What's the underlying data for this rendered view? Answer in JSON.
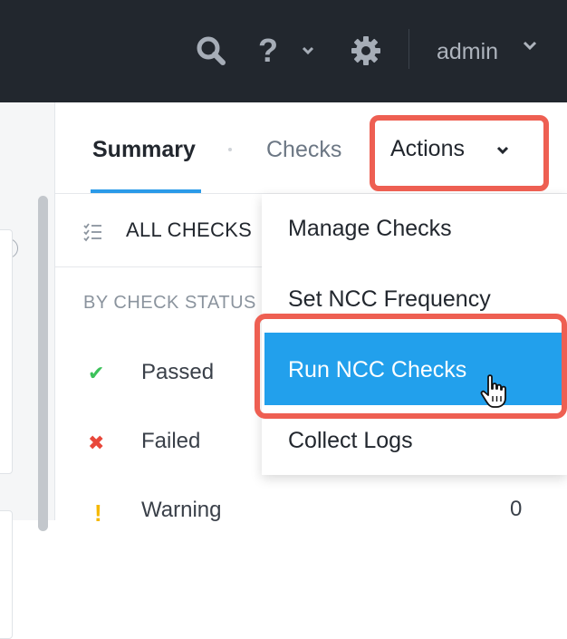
{
  "topbar": {
    "icons": [
      "search-icon",
      "help-icon",
      "chevron-down-icon",
      "gear-icon",
      "chevron-down-icon"
    ],
    "help_glyph": "?",
    "user_label": "admin"
  },
  "tabs": [
    {
      "label": "Summary",
      "active": true
    },
    {
      "label": "Checks",
      "active": false
    },
    {
      "label": "Actions",
      "active": false,
      "has_dropdown": true
    }
  ],
  "sidebar": {
    "help_glyph": "?",
    "all_checks_label": "ALL CHECKS",
    "by_status_heading": "BY CHECK STATUS",
    "statuses": [
      {
        "label": "Passed",
        "icon": "check-icon",
        "glyph": "✔",
        "color": "#3cc25a"
      },
      {
        "label": "Failed",
        "icon": "x-icon",
        "glyph": "✖",
        "color": "#e8473a"
      },
      {
        "label": "Warning",
        "icon": "exclamation-icon",
        "glyph": "!",
        "color": "#f5b800",
        "count": "0"
      }
    ]
  },
  "actions_menu": {
    "items": [
      {
        "label": "Manage Checks",
        "active": false
      },
      {
        "label": "Set NCC Frequency",
        "active": false
      },
      {
        "label": "Run NCC Checks",
        "active": true
      },
      {
        "label": "Collect Logs",
        "active": false
      }
    ]
  },
  "colors": {
    "topbar_bg": "#22272e",
    "accent": "#2b9ae8",
    "menu_active_bg": "#22a0ec",
    "highlight_border": "#ee5f52"
  }
}
